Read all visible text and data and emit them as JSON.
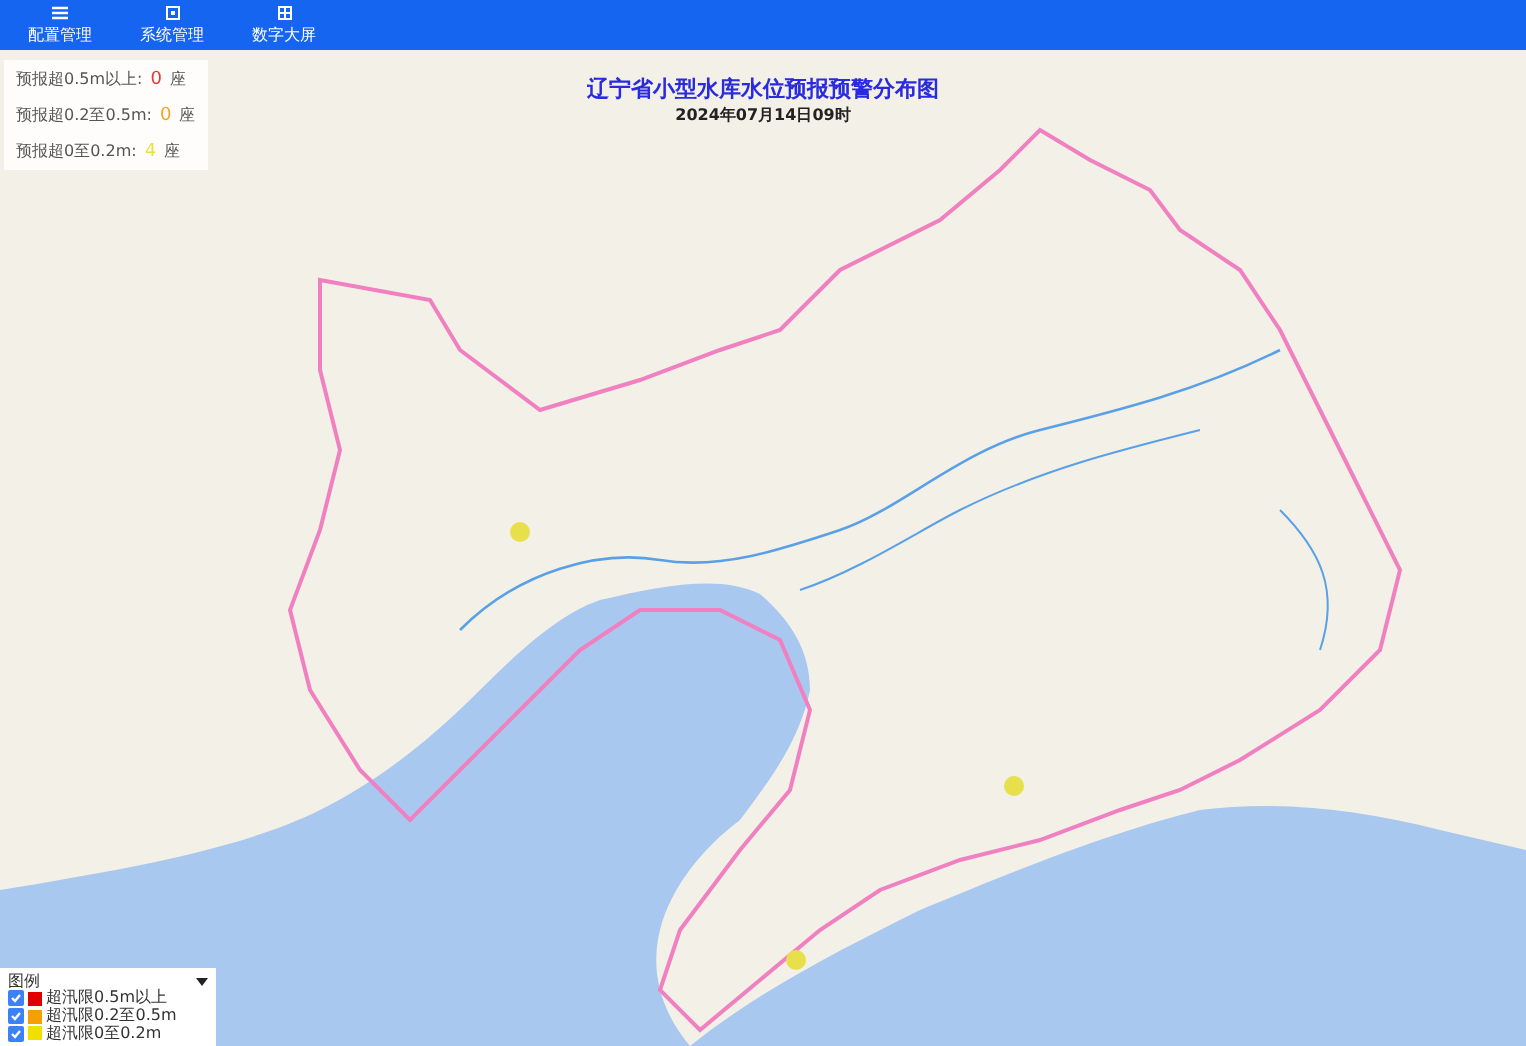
{
  "nav": [
    {
      "label": "配置管理",
      "kind": "list"
    },
    {
      "label": "系统管理",
      "kind": "square"
    },
    {
      "label": "数字大屏",
      "kind": "screen"
    }
  ],
  "counts": [
    {
      "label": "预报超0.5m以上:",
      "count": "0",
      "unit": "座",
      "color": "#e53935"
    },
    {
      "label": "预报超0.2至0.5m:",
      "count": "0",
      "unit": "座",
      "color": "#f5a623"
    },
    {
      "label": "预报超0至0.2m:",
      "count": "4",
      "unit": "座",
      "color": "#e8e04a"
    }
  ],
  "title": "辽宁省小型水库水位预报预警分布图",
  "subtitle": "2024年07月14日09时",
  "legend": {
    "title": "图例",
    "items": [
      {
        "label": "超汛限0.5m以上",
        "checked": true,
        "color": "#e00000"
      },
      {
        "label": "超汛限0.2至0.5m",
        "checked": true,
        "color": "#f5a000"
      },
      {
        "label": "超汛限0至0.2m",
        "checked": true,
        "color": "#f0e000"
      }
    ]
  }
}
